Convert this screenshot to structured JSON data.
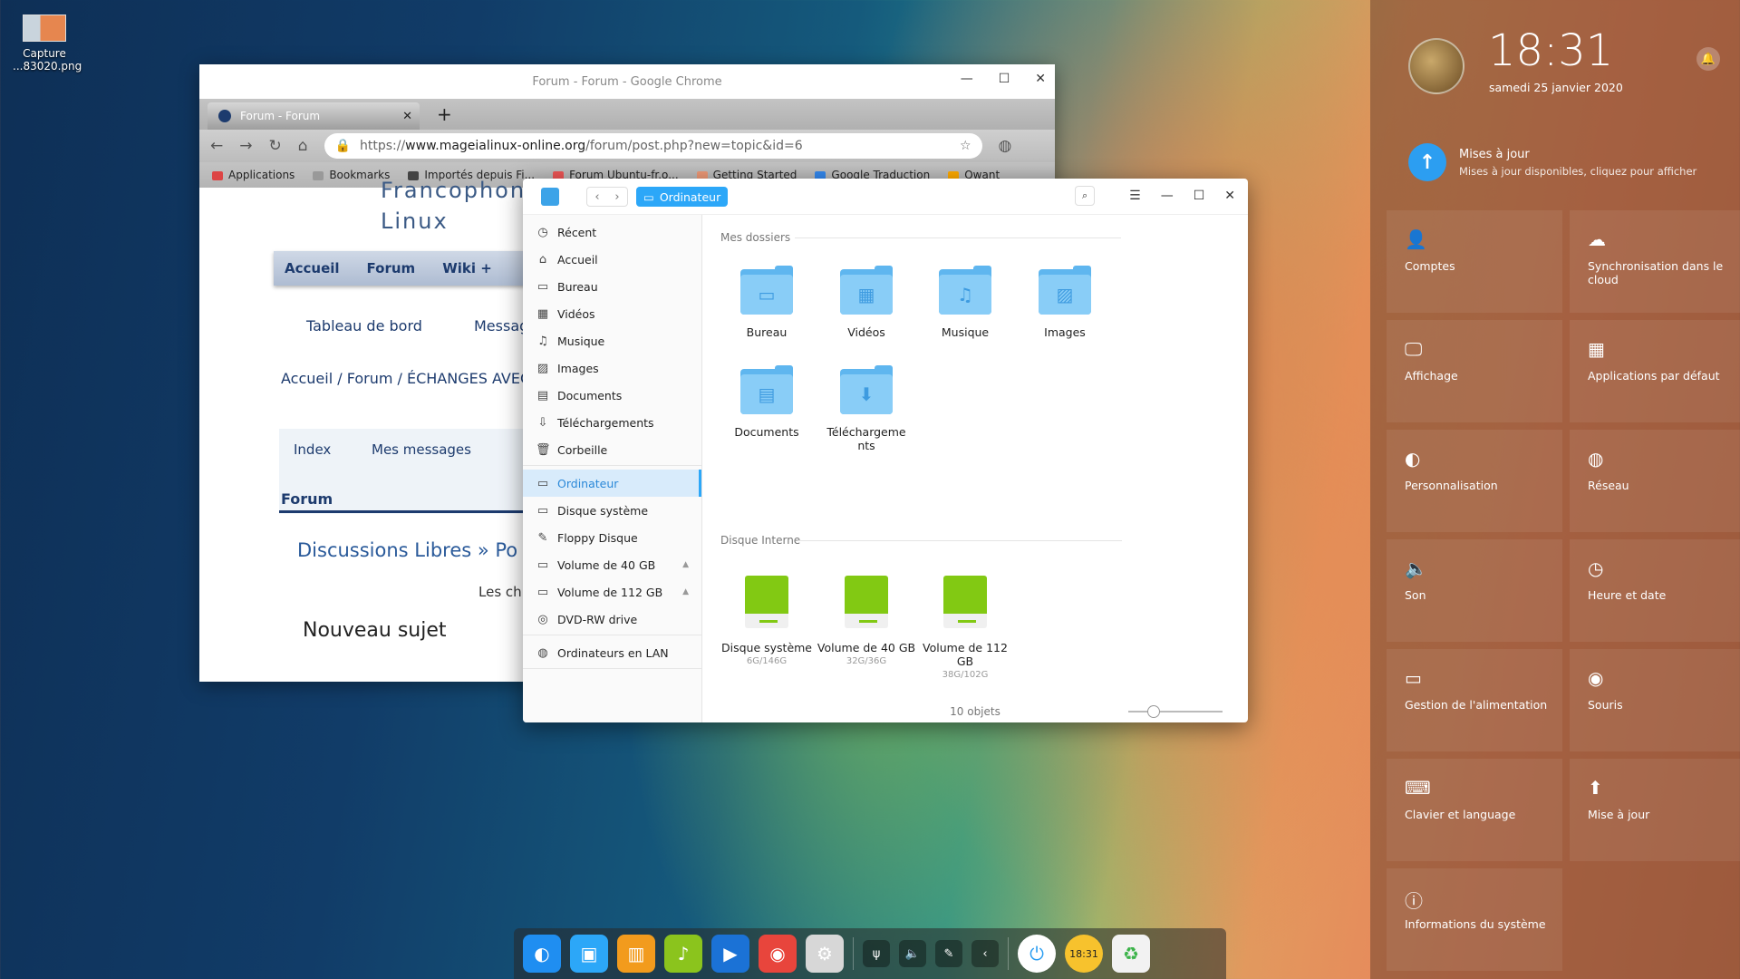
{
  "desktop": {
    "icon_label_1": "Capture",
    "icon_label_2": "...83020.png"
  },
  "chrome": {
    "window_title": "Forum - Forum - Google Chrome",
    "tab_title": "Forum - Forum",
    "url_prefix": "https://",
    "url_host": "www.mageialinux-online.org",
    "url_path": "/forum/post.php?new=topic&id=6",
    "bookmarks": [
      "Applications",
      "Bookmarks",
      "Importés depuis Fi...",
      "Forum Ubuntu-fr.o...",
      "Getting Started",
      "Google Traduction",
      "Qwant"
    ],
    "page": {
      "title_line1": "Francophon",
      "title_line2": "Linux",
      "nav": [
        "Accueil",
        "Forum",
        "Wiki +"
      ],
      "tableau": "Tableau de bord",
      "messag": "Messag",
      "breadcrumb": "Accueil / Forum / ÉCHANGES AVEC",
      "index": "Index",
      "mes_messages": "Mes messages",
      "forum": "Forum",
      "discussions": "Discussions Libres » Po",
      "les_ch": "Les ch",
      "nouveau": "Nouveau sujet"
    }
  },
  "fm": {
    "crumb": "Ordinateur",
    "sidebar": [
      {
        "label": "Récent",
        "icon": "clock-icon",
        "glyph": "◷"
      },
      {
        "label": "Accueil",
        "icon": "home-icon",
        "glyph": "⌂"
      },
      {
        "label": "Bureau",
        "icon": "desktop-icon",
        "glyph": "▭"
      },
      {
        "label": "Vidéos",
        "icon": "video-icon",
        "glyph": "▦"
      },
      {
        "label": "Musique",
        "icon": "music-icon",
        "glyph": "♫"
      },
      {
        "label": "Images",
        "icon": "image-icon",
        "glyph": "▨"
      },
      {
        "label": "Documents",
        "icon": "document-icon",
        "glyph": "▤"
      },
      {
        "label": "Téléchargements",
        "icon": "download-icon",
        "glyph": "⇩"
      },
      {
        "label": "Corbeille",
        "icon": "trash-icon",
        "glyph": "🗑"
      }
    ],
    "sidebar2": [
      {
        "label": "Ordinateur",
        "icon": "computer-icon",
        "glyph": "▭"
      },
      {
        "label": "Disque système",
        "icon": "disk-icon",
        "glyph": "▭"
      },
      {
        "label": "Floppy Disque",
        "icon": "floppy-icon",
        "glyph": "✎"
      },
      {
        "label": "Volume de 40 GB",
        "icon": "disk-icon",
        "glyph": "▭"
      },
      {
        "label": "Volume de 112 GB",
        "icon": "disk-icon",
        "glyph": "▭"
      },
      {
        "label": "DVD-RW drive",
        "icon": "dvd-icon",
        "glyph": "◎"
      }
    ],
    "sidebar3": [
      {
        "label": "Ordinateurs en LAN",
        "icon": "network-icon",
        "glyph": "◍"
      }
    ],
    "section_folders": "Mes dossiers",
    "folders": [
      {
        "label": "Bureau",
        "glyph": "▭"
      },
      {
        "label": "Vidéos",
        "glyph": "▦"
      },
      {
        "label": "Musique",
        "glyph": "♫"
      },
      {
        "label": "Images",
        "glyph": "▨"
      },
      {
        "label": "Documents",
        "glyph": "▤"
      },
      {
        "label": "Téléchargeme nts",
        "glyph": "⬇"
      }
    ],
    "section_disks": "Disque Interne",
    "disks": [
      {
        "label": "Disque système",
        "usage": "6G/146G"
      },
      {
        "label": "Volume de 40 GB",
        "usage": "32G/36G"
      },
      {
        "label": "Volume de 112 GB",
        "usage": "38G/102G"
      }
    ],
    "status": "10 objets",
    "zoom_level": 0.2
  },
  "panel": {
    "time": "18:31",
    "date": "samedi 25 janvier 2020",
    "update_title": "Mises à jour",
    "update_sub": "Mises à jour disponibles, cliquez pour afficher",
    "tiles": [
      {
        "label": "Comptes",
        "glyph": "👤"
      },
      {
        "label": "Synchronisation dans le cloud",
        "glyph": "☁"
      },
      {
        "label": "Affichage",
        "glyph": "🖵"
      },
      {
        "label": "Applications par défaut",
        "glyph": "▦"
      },
      {
        "label": "Personnalisation",
        "glyph": "◐"
      },
      {
        "label": "Réseau",
        "glyph": "◍"
      },
      {
        "label": "Son",
        "glyph": "🔈"
      },
      {
        "label": "Heure et date",
        "glyph": "◷"
      },
      {
        "label": "Gestion de l'alimentation",
        "glyph": "▭"
      },
      {
        "label": "Souris",
        "glyph": "◉"
      },
      {
        "label": "Clavier et language",
        "glyph": "⌨"
      },
      {
        "label": "Mise à jour",
        "glyph": "⬆"
      },
      {
        "label": "Informations du système",
        "glyph": "ⓘ"
      }
    ]
  },
  "dock": {
    "apps": [
      {
        "name": "launcher-icon",
        "color": "#1f8ef1",
        "glyph": "◐"
      },
      {
        "name": "file-manager-icon",
        "color": "#2ca7f8",
        "glyph": "▣"
      },
      {
        "name": "store-icon",
        "color": "#f29b1d",
        "glyph": "▥"
      },
      {
        "name": "music-player-icon",
        "color": "#8bc41d",
        "glyph": "♪"
      },
      {
        "name": "video-player-icon",
        "color": "#1b72d6",
        "glyph": "▶"
      },
      {
        "name": "chrome-icon",
        "color": "#e8453c",
        "glyph": "◉"
      },
      {
        "name": "settings-icon",
        "color": "#d7d7d7",
        "glyph": "⚙"
      }
    ],
    "tray": [
      {
        "name": "usb-icon",
        "glyph": "ψ"
      },
      {
        "name": "volume-icon",
        "glyph": "🔈"
      },
      {
        "name": "pen-icon",
        "glyph": "✎"
      },
      {
        "name": "collapse-icon",
        "glyph": "‹"
      }
    ],
    "power_glyph": "⏻",
    "clock_glyph": "18:31",
    "trash_glyph": "♻"
  }
}
